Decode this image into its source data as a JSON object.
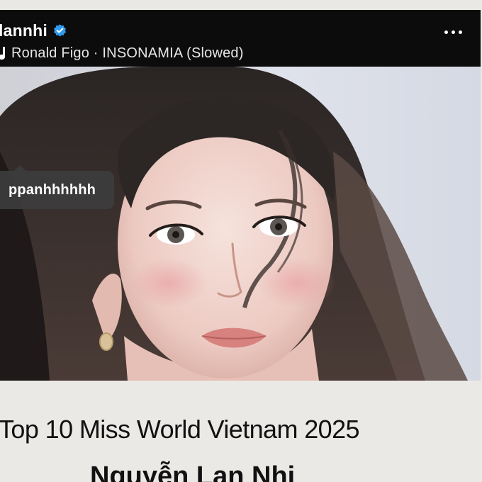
{
  "post": {
    "username": "lannhi",
    "verified_icon": "verified-badge-icon",
    "music": "Ronald Figo · INSONAMIA (Slowed)",
    "music_icon": "music-note-icon",
    "more_icon": "more-options-icon",
    "tag": "ppanhhhhhh",
    "photo": "portrait-photo"
  },
  "caption": {
    "line1": "Top 10 Miss World Vietnam 2025",
    "line2": "Nguyễn Lan Nhi"
  },
  "colors": {
    "header_bg": "#0c0c0d",
    "verified_blue": "#2f9bf0",
    "page_bg": "#ebe9e6",
    "tag_bg": "#3e3e3e"
  }
}
